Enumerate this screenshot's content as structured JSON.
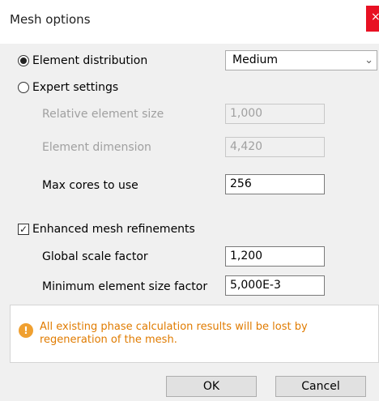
{
  "window": {
    "title": "Mesh options",
    "close_icon": "close-icon"
  },
  "element_distribution": {
    "label": "Element distribution",
    "selected": true,
    "value": "Medium",
    "chevron": "⌄"
  },
  "expert_settings": {
    "label": "Expert settings",
    "selected": false
  },
  "relative_element_size": {
    "label": "Relative element size",
    "value": "1,000",
    "enabled": false
  },
  "element_dimension": {
    "label": "Element dimension",
    "value": "4,420",
    "enabled": false
  },
  "max_cores": {
    "label": "Max cores to use",
    "value": "256"
  },
  "enhanced_refinements": {
    "label": "Enhanced mesh refinements",
    "checked": true,
    "check_glyph": "✓"
  },
  "global_scale_factor": {
    "label": "Global scale factor",
    "value": "1,200"
  },
  "min_element_size_factor": {
    "label": "Minimum element size factor",
    "value": "5,000E-3"
  },
  "warning": {
    "icon": "warning-icon",
    "icon_glyph": "!",
    "text": "All existing phase calculation results will be lost by regeneration of the mesh.",
    "color": "#e07b00"
  },
  "buttons": {
    "ok": "OK",
    "cancel": "Cancel"
  },
  "colors": {
    "close_button": "#e81123",
    "panel_background": "#f0f0f0"
  }
}
